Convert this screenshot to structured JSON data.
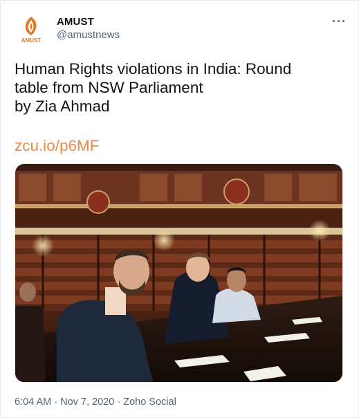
{
  "author": {
    "display_name": "AMUST",
    "handle": "@amustnews",
    "logo_text": "AMUST",
    "brand_color": "#e07b22"
  },
  "tweet": {
    "text_lines": [
      "Human Rights violations in India: Round",
      "table from NSW Parliament",
      "by Zia Ahmad"
    ],
    "link": "zcu.io/p6MF",
    "link_color": "#ea8a45"
  },
  "photo": {
    "alt": "Men seated at a conference table in the NSW Parliament library"
  },
  "meta": {
    "time": "6:04 AM",
    "separator": "·",
    "date": "Nov 7, 2020",
    "source": "Zoho Social"
  },
  "icons": {
    "more": "more-horizontal-icon"
  }
}
